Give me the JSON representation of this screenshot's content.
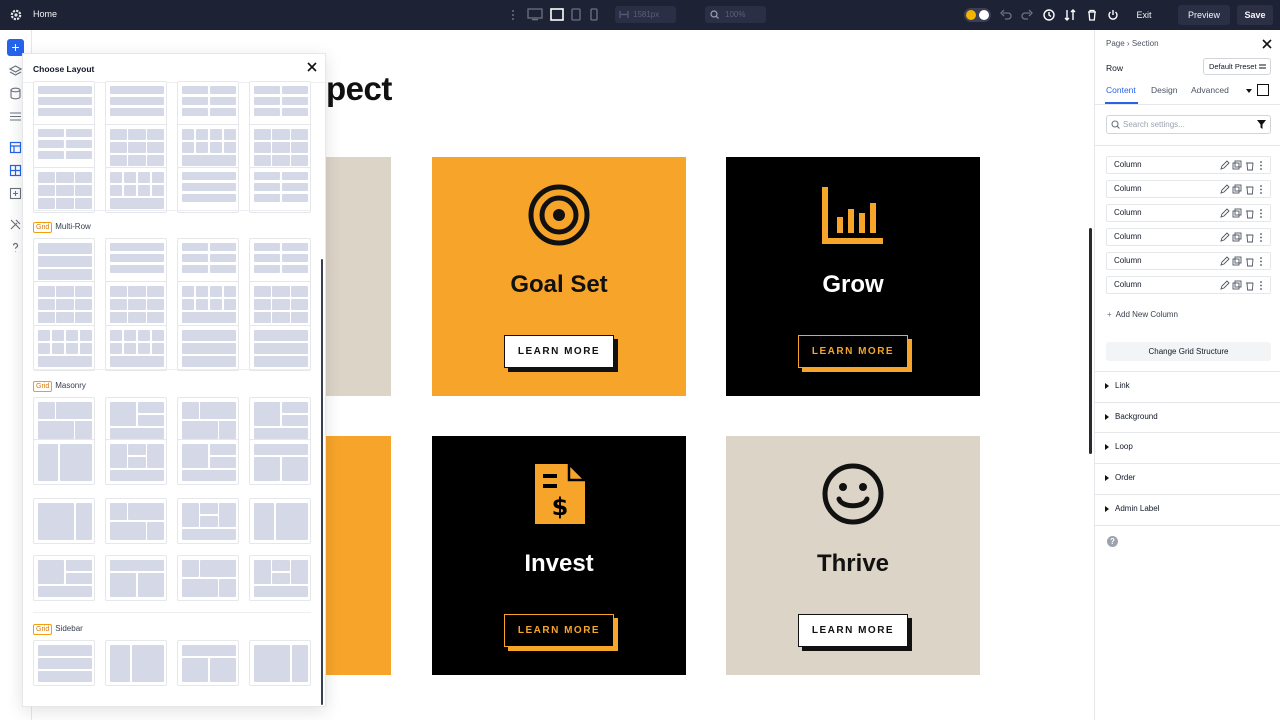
{
  "topbar": {
    "page_name": "Home",
    "width_value": "1581px",
    "zoom_value": "100%",
    "exit_label": "Exit",
    "preview_label": "Preview",
    "save_label": "Save"
  },
  "layout_panel": {
    "title": "Choose Layout",
    "tag": "Grid",
    "sections": {
      "multi_row": "Multi-Row",
      "masonry": "Masonry",
      "sidebar": "Sidebar"
    }
  },
  "canvas": {
    "heading": "pect",
    "cards": [
      {
        "title": "Goal Set",
        "button": "LEARN MORE"
      },
      {
        "title": "Grow",
        "button": "LEARN MORE"
      },
      {
        "title": "Invest",
        "button": "LEARN MORE"
      },
      {
        "title": "Thrive",
        "button": "LEARN MORE"
      }
    ],
    "colors": {
      "orange": "#f7a52a",
      "black": "#000000",
      "beige": "#ddd4c8"
    }
  },
  "settings": {
    "breadcrumb_page": "Page",
    "breadcrumb_sep": "›",
    "breadcrumb_section": "Section",
    "element": "Row",
    "preset": "Default Preset",
    "tabs": [
      "Content",
      "Design",
      "Advanced"
    ],
    "search_placeholder": "Search settings...",
    "columns": [
      "Column",
      "Column",
      "Column",
      "Column",
      "Column",
      "Column"
    ],
    "add_column": "Add New Column",
    "change_grid": "Change Grid Structure",
    "accordions": [
      "Link",
      "Background",
      "Loop",
      "Order",
      "Admin Label"
    ]
  }
}
